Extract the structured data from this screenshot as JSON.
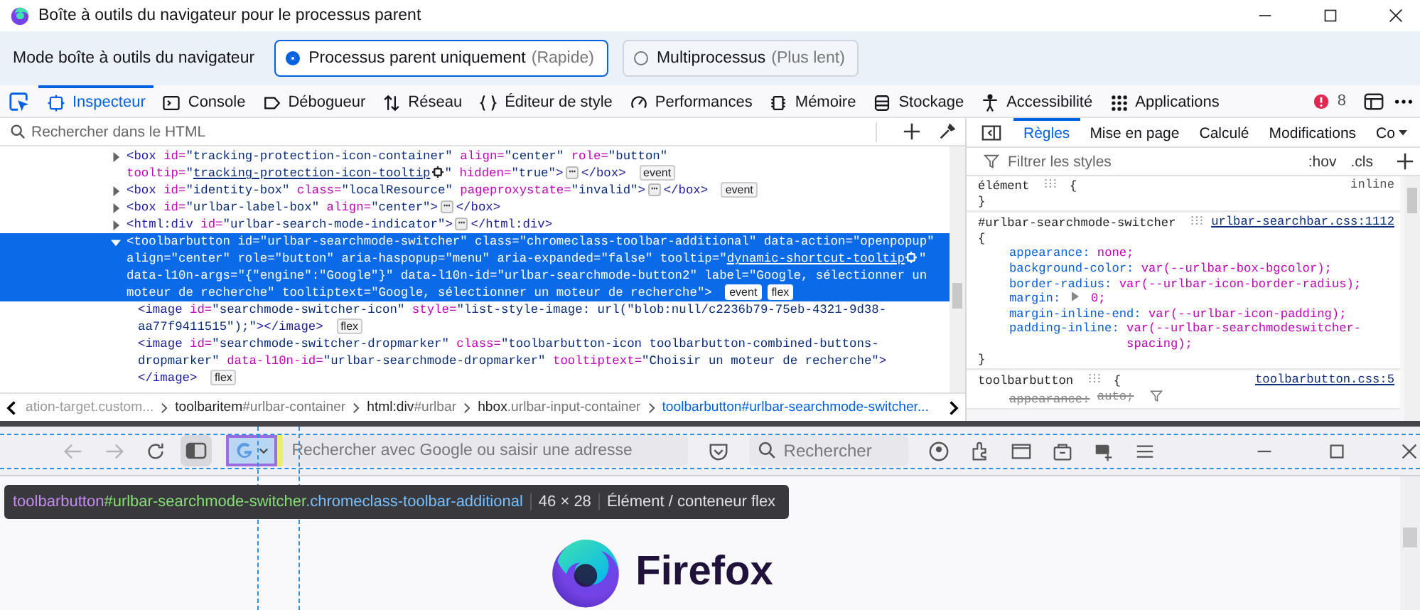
{
  "window": {
    "title": "Boîte à outils du navigateur pour le processus parent"
  },
  "mode_bar": {
    "label": "Mode boîte à outils du navigateur",
    "options": [
      {
        "label": "Processus parent uniquement",
        "hint": "(Rapide)",
        "selected": true
      },
      {
        "label": "Multiprocessus",
        "hint": "(Plus lent)",
        "selected": false
      }
    ]
  },
  "toolbox_tabs": [
    {
      "label": "Inspecteur",
      "selected": true
    },
    {
      "label": "Console",
      "selected": false
    },
    {
      "label": "Débogueur",
      "selected": false
    },
    {
      "label": "Réseau",
      "selected": false
    },
    {
      "label": "Éditeur de style",
      "selected": false
    },
    {
      "label": "Performances",
      "selected": false
    },
    {
      "label": "Mémoire",
      "selected": false
    },
    {
      "label": "Stockage",
      "selected": false
    },
    {
      "label": "Accessibilité",
      "selected": false
    },
    {
      "label": "Applications",
      "selected": false
    }
  ],
  "error_count": "8",
  "inspector": {
    "search": {
      "placeholder": "Rechercher dans le HTML"
    },
    "nodes": [
      {
        "expanded": false,
        "selected": false,
        "segments": [
          {
            "kind": "tag",
            "text": "<box"
          },
          {
            "kind": "attr",
            "text": " id="
          },
          {
            "kind": "value",
            "text": "\"tracking-protection-icon-container\""
          },
          {
            "kind": "attr",
            "text": " align="
          },
          {
            "kind": "value",
            "text": "\"center\""
          },
          {
            "kind": "attr",
            "text": " role="
          },
          {
            "kind": "value",
            "text": "\"button\""
          },
          {
            "kind": "attr",
            "text": " tooltip="
          },
          {
            "kind": "value",
            "text": "\""
          },
          {
            "kind": "link",
            "text": "tracking-protection-icon-tooltip"
          },
          {
            "kind": "target"
          },
          {
            "kind": "value",
            "text": "\""
          },
          {
            "kind": "attr",
            "text": " hidden="
          },
          {
            "kind": "value",
            "text": "\"true\""
          },
          {
            "kind": "tag",
            "text": ">"
          },
          {
            "kind": "ellipsis",
            "text": "⋯"
          },
          {
            "kind": "tag",
            "text": "</box>"
          }
        ],
        "badges": [
          "event"
        ]
      },
      {
        "expanded": false,
        "selected": false,
        "segments": [
          {
            "kind": "tag",
            "text": "<box"
          },
          {
            "kind": "attr",
            "text": " id="
          },
          {
            "kind": "value",
            "text": "\"identity-box\""
          },
          {
            "kind": "attr",
            "text": " class="
          },
          {
            "kind": "value",
            "text": "\"localResource\""
          },
          {
            "kind": "attr",
            "text": " pageproxystate="
          },
          {
            "kind": "value",
            "text": "\"invalid\""
          },
          {
            "kind": "tag",
            "text": ">"
          },
          {
            "kind": "ellipsis",
            "text": "⋯"
          },
          {
            "kind": "tag",
            "text": "</box>"
          }
        ],
        "badges": [
          "event"
        ]
      },
      {
        "expanded": false,
        "selected": false,
        "segments": [
          {
            "kind": "tag",
            "text": "<box"
          },
          {
            "kind": "attr",
            "text": " id="
          },
          {
            "kind": "value",
            "text": "\"urlbar-label-box\""
          },
          {
            "kind": "attr",
            "text": " align="
          },
          {
            "kind": "value",
            "text": "\"center\""
          },
          {
            "kind": "tag",
            "text": ">"
          },
          {
            "kind": "ellipsis",
            "text": "⋯"
          },
          {
            "kind": "tag",
            "text": "</box>"
          }
        ]
      },
      {
        "expanded": false,
        "selected": false,
        "segments": [
          {
            "kind": "tag",
            "text": "<html:div"
          },
          {
            "kind": "attr",
            "text": " id="
          },
          {
            "kind": "value",
            "text": "\"urlbar-search-mode-indicator\""
          },
          {
            "kind": "tag",
            "text": ">"
          },
          {
            "kind": "ellipsis",
            "text": "⋯"
          },
          {
            "kind": "tag",
            "text": "</html:div>"
          }
        ]
      },
      {
        "expanded": true,
        "selected": true,
        "segments": [
          {
            "kind": "tag",
            "text": "<toolbarbutton"
          },
          {
            "kind": "attr",
            "text": " id="
          },
          {
            "kind": "value",
            "text": "\"urlbar-searchmode-switcher\""
          },
          {
            "kind": "attr",
            "text": " class="
          },
          {
            "kind": "value",
            "text": "\"chromeclass-toolbar-additional\""
          },
          {
            "kind": "attr",
            "text": " data-action="
          },
          {
            "kind": "value",
            "text": "\"openpopup\""
          },
          {
            "kind": "attr",
            "text": " align="
          },
          {
            "kind": "value",
            "text": "\"center\""
          },
          {
            "kind": "attr",
            "text": " role="
          },
          {
            "kind": "value",
            "text": "\"button\""
          },
          {
            "kind": "attr",
            "text": " aria-haspopup="
          },
          {
            "kind": "value",
            "text": "\"menu\""
          },
          {
            "kind": "attr",
            "text": " aria-expanded="
          },
          {
            "kind": "value",
            "text": "\"false\""
          },
          {
            "kind": "attr",
            "text": " tooltip="
          },
          {
            "kind": "value",
            "text": "\""
          },
          {
            "kind": "link",
            "text": "dynamic-shortcut-tooltip"
          },
          {
            "kind": "target"
          },
          {
            "kind": "value",
            "text": "\""
          },
          {
            "kind": "attr",
            "text": " data-l10n-args="
          },
          {
            "kind": "value",
            "text": "\"{\"engine\":\"Google\"}\""
          },
          {
            "kind": "attr",
            "text": " data-l10n-id="
          },
          {
            "kind": "value",
            "text": "\"urlbar-searchmode-button2\""
          },
          {
            "kind": "attr",
            "text": " label="
          },
          {
            "kind": "value",
            "text": "\"Google, sélectionner un moteur de recherche\""
          },
          {
            "kind": "attr",
            "text": " tooltiptext="
          },
          {
            "kind": "value",
            "text": "\"Google, sélectionner un moteur de recherche\""
          },
          {
            "kind": "tag",
            "text": ">"
          }
        ],
        "badges": [
          "event",
          "flex"
        ],
        "children": [
          {
            "selected": false,
            "segments": [
              {
                "kind": "tag",
                "text": "<image"
              },
              {
                "kind": "attr",
                "text": " id="
              },
              {
                "kind": "value",
                "text": "\"searchmode-switcher-icon\""
              },
              {
                "kind": "attr",
                "text": " style="
              },
              {
                "kind": "value",
                "text": "\"list-style-image: url(\"blob:null/c2236b79-75eb-4321-9d38-aa77f9411515\");\""
              },
              {
                "kind": "tag",
                "text": "></image>"
              }
            ],
            "badges": [
              "flex"
            ]
          },
          {
            "selected": false,
            "segments": [
              {
                "kind": "tag",
                "text": "<image"
              },
              {
                "kind": "attr",
                "text": " id="
              },
              {
                "kind": "value",
                "text": "\"searchmode-switcher-dropmarker\""
              },
              {
                "kind": "attr",
                "text": " class="
              },
              {
                "kind": "value",
                "text": "\"toolbarbutton-icon toolbarbutton-combined-buttons-dropmarker\""
              },
              {
                "kind": "attr",
                "text": " data-l10n-id="
              },
              {
                "kind": "value",
                "text": "\"urlbar-searchmode-dropmarker\""
              },
              {
                "kind": "attr",
                "text": " tooltiptext="
              },
              {
                "kind": "value",
                "text": "\"Choisir un moteur de recherche\""
              },
              {
                "kind": "tag",
                "text": "></image>"
              }
            ],
            "badges": [
              "flex"
            ]
          }
        ]
      }
    ],
    "breadcrumbs": [
      {
        "selector": "ation-target.custom...",
        "selected": false
      },
      {
        "element": "toolbaritem",
        "selector": "#urlbar-container",
        "selected": false
      },
      {
        "element": "html:div",
        "selector": "#urlbar",
        "selected": false
      },
      {
        "element": "hbox",
        "selector": ".urlbar-input-container",
        "selected": false
      },
      {
        "element": "toolbarbutton",
        "selector": "#urlbar-searchmode-switcher...",
        "selected": true
      }
    ]
  },
  "rules_panel": {
    "tabs": [
      {
        "label": "Règles",
        "selected": true
      },
      {
        "label": "Mise en page",
        "selected": false
      },
      {
        "label": "Calculé",
        "selected": false
      },
      {
        "label": "Modifications",
        "selected": false
      },
      {
        "label": "Co",
        "selected": false
      }
    ],
    "filter": {
      "placeholder": "Filtrer les styles"
    },
    "hov": ":hov",
    "cls": ".cls",
    "rules": [
      {
        "selector": "élément",
        "open": "{",
        "close": "}",
        "source": "inline",
        "link": false
      },
      {
        "selector": "#urlbar-searchmode-switcher",
        "open": "{",
        "close": "}",
        "source": "urlbar-searchbar.css:1112",
        "link": true,
        "declarations": [
          {
            "property": "appearance:",
            "value": "none;",
            "expandable": false,
            "overridden": false
          },
          {
            "property": "background-color:",
            "value": "var(--urlbar-box-bgcolor);",
            "expandable": false,
            "overridden": false
          },
          {
            "property": "border-radius:",
            "value": "var(--urlbar-icon-border-radius);",
            "expandable": false,
            "overridden": false
          },
          {
            "property": "margin:",
            "value": "0;",
            "expandable": true,
            "overridden": false
          },
          {
            "property": "margin-inline-end:",
            "value": "var(--urlbar-icon-padding);",
            "expandable": false,
            "overridden": false
          },
          {
            "property": "padding-inline:",
            "value": "var(--urlbar-searchmodeswitcher-spacing);",
            "expandable": false,
            "overridden": false
          }
        ]
      },
      {
        "selector": "toolbarbutton",
        "open": "{",
        "source": "toolbarbutton.css:5",
        "link": true,
        "declarations": [
          {
            "property": "appearance:",
            "value": "auto;",
            "expandable": false,
            "overridden": true
          }
        ]
      }
    ]
  },
  "preview": {
    "url_field": {
      "placeholder": "Rechercher avec Google ou saisir une adresse"
    },
    "search_field": {
      "placeholder": "Rechercher"
    },
    "infobar": {
      "selector": [
        {
          "kind": "tag",
          "text": "toolbarbutton"
        },
        {
          "kind": "id",
          "text": "#urlbar-searchmode-switcher"
        },
        {
          "kind": "class",
          "text": ".chromeclass-toolbar-additional"
        }
      ],
      "size": "46 × 28",
      "type": "Élément / conteneur flex"
    },
    "brand": "Firefox"
  }
}
